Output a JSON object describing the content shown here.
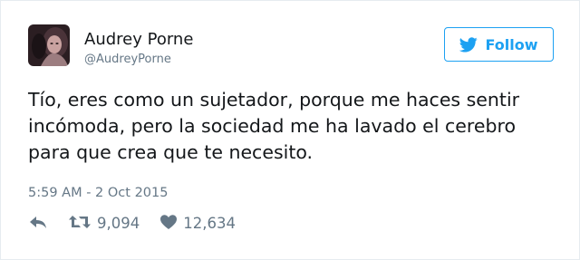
{
  "author": {
    "name": "Audrey Porne",
    "handle": "@AudreyPorne"
  },
  "follow_button": {
    "label": "Follow",
    "icon": "twitter-bird-icon"
  },
  "tweet": {
    "lines": [
      "Tío, eres como un sujetador, porque me haces sentir",
      "incómoda, pero la sociedad me ha lavado el cerebro",
      "para que crea que te necesito."
    ],
    "timestamp": "5:59 AM - 2 Oct 2015"
  },
  "actions": {
    "reply_icon": "reply-icon",
    "retweet_icon": "retweet-icon",
    "retweet_count": "9,094",
    "like_icon": "heart-icon",
    "like_count": "12,634"
  },
  "colors": {
    "accent": "#1da1f2",
    "text": "#14171a",
    "muted": "#657786",
    "border": "#e6ecf0"
  }
}
